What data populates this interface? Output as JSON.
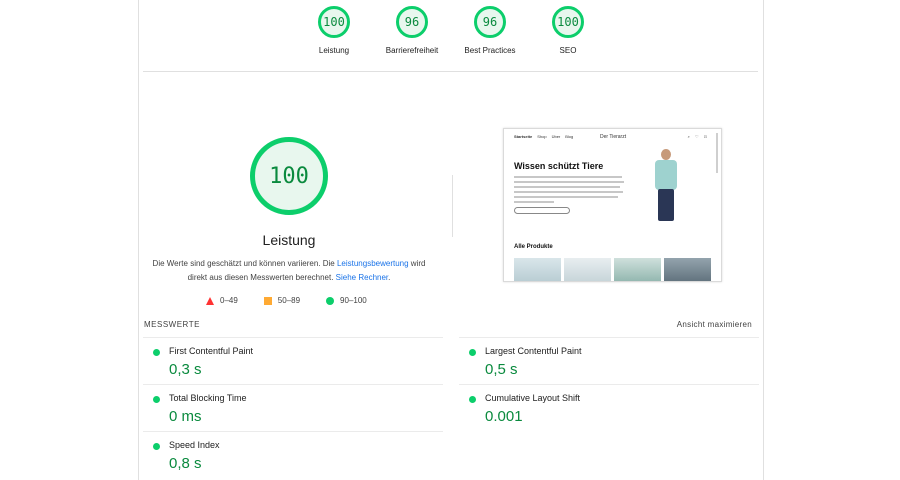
{
  "top_scores": [
    {
      "score": "100",
      "label": "Leistung"
    },
    {
      "score": "96",
      "label": "Barrierefreiheit"
    },
    {
      "score": "96",
      "label": "Best Practices"
    },
    {
      "score": "100",
      "label": "SEO"
    }
  ],
  "main": {
    "score": "100",
    "title": "Leistung",
    "desc_1": "Die Werte sind geschätzt und können variieren. Die ",
    "desc_link_1": "Leistungsbewertung",
    "desc_2": " wird direkt aus diesen Messwerten berechnet. ",
    "desc_link_2": "Siehe Rechner",
    "desc_3": "."
  },
  "legend": {
    "fail": "0–49",
    "average": "50–89",
    "pass": "90–100"
  },
  "thumbnail": {
    "nav_items": [
      "Startseite",
      "Shop",
      "Über",
      "Blog"
    ],
    "brand": "Der Tierarzt",
    "headline": "Wissen schützt Tiere",
    "products_title": "Alle Produkte"
  },
  "metrics": {
    "section_label": "MESSWERTE",
    "expand_label": "Ansicht maximieren",
    "items": [
      {
        "name": "First Contentful Paint",
        "value": "0,3 s"
      },
      {
        "name": "Largest Contentful Paint",
        "value": "0,5 s"
      },
      {
        "name": "Total Blocking Time",
        "value": "0 ms"
      },
      {
        "name": "Cumulative Layout Shift",
        "value": "0.001"
      },
      {
        "name": "Speed Index",
        "value": "0,8 s"
      }
    ]
  },
  "colors": {
    "pass": "#0cce6b",
    "pass_text": "#0a8a3e",
    "average": "#ffaa33",
    "fail": "#ff3333",
    "link": "#1a73e8"
  }
}
